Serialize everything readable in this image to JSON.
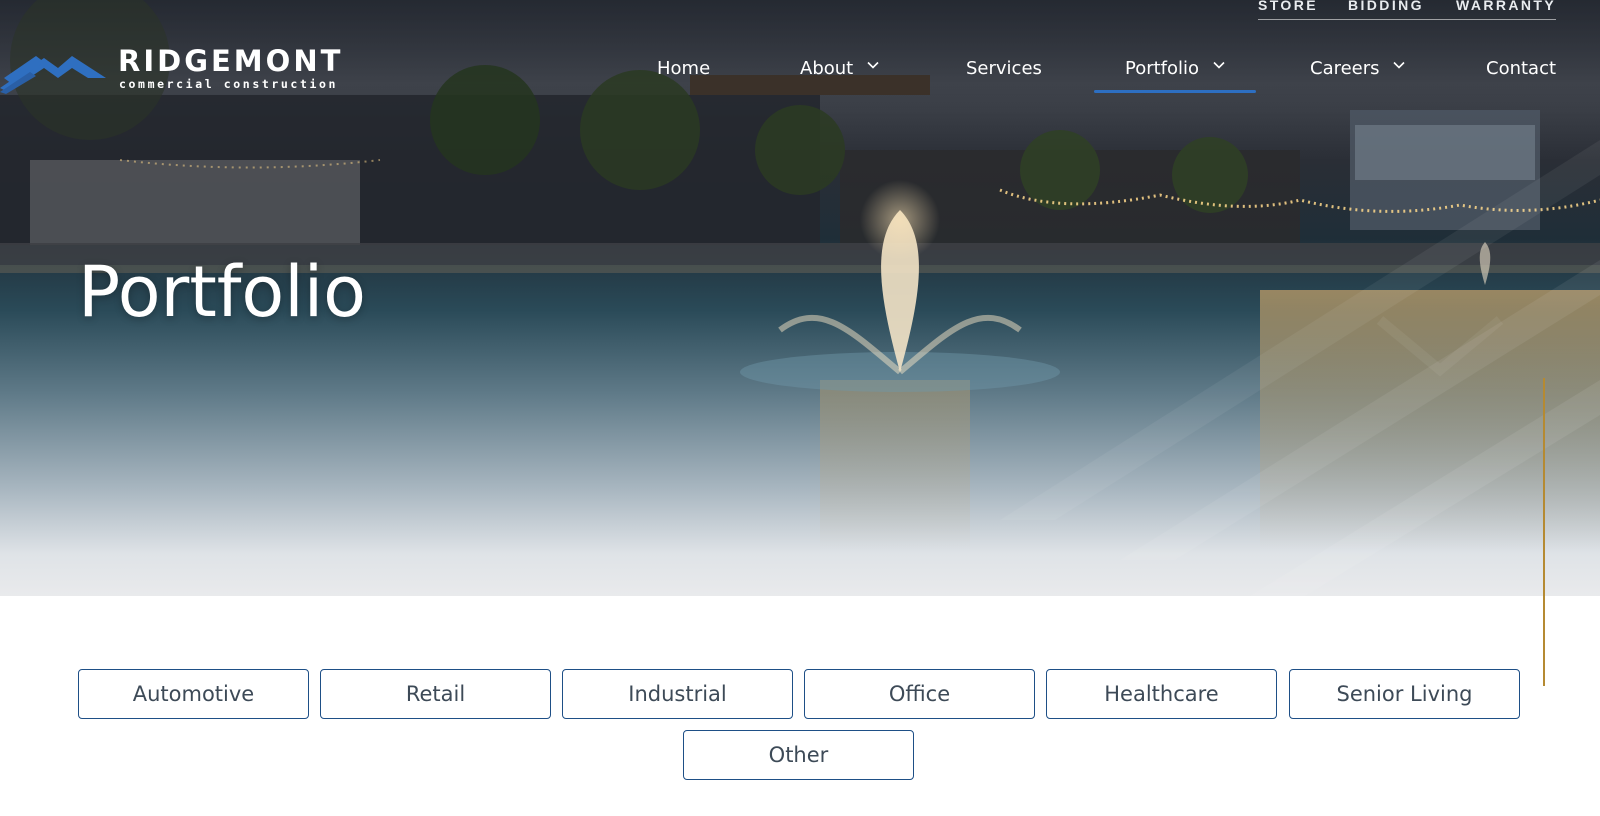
{
  "brand": {
    "name": "RIDGEMONT",
    "tagline": "commercial construction"
  },
  "utility_nav": [
    "STORE",
    "BIDDING",
    "WARRANTY"
  ],
  "main_nav": {
    "items": [
      {
        "label": "Home",
        "has_dropdown": false
      },
      {
        "label": "About",
        "has_dropdown": true
      },
      {
        "label": "Services",
        "has_dropdown": false
      },
      {
        "label": "Portfolio",
        "has_dropdown": true,
        "active": true
      },
      {
        "label": "Careers",
        "has_dropdown": true
      },
      {
        "label": "Contact",
        "has_dropdown": false
      }
    ]
  },
  "hero": {
    "title": "Portfolio"
  },
  "filters": [
    "Automotive",
    "Retail",
    "Industrial",
    "Office",
    "Healthcare",
    "Senior Living",
    "Other"
  ],
  "colors": {
    "accent_blue": "#2d6fc2",
    "button_border": "#1e4f86",
    "gold_rule": "#b58a32",
    "logo_blue": "#2f6fc0"
  }
}
